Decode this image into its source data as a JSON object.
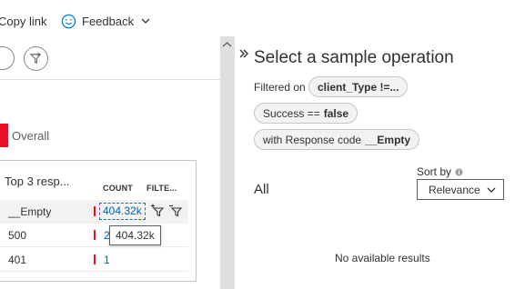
{
  "toolbar": {
    "copy_link_label": "Copy link",
    "feedback_label": "Feedback",
    "feedback_icon": "smiley-icon"
  },
  "left": {
    "overall_label": "Overall",
    "overall_color": "#e81123",
    "card": {
      "title": "Top 3 resp...",
      "columns": [
        "COUNT",
        "FILTE..."
      ],
      "rows": [
        {
          "code": "__Empty",
          "count": "404.32k"
        },
        {
          "code": "500",
          "count": "26"
        },
        {
          "code": "401",
          "count": "1"
        }
      ]
    },
    "tooltip": "404.32k"
  },
  "right": {
    "title": "Select a sample operation",
    "filtered_on_label": "Filtered on",
    "chips": [
      {
        "key": "",
        "value": "client_Type !=..."
      },
      {
        "key": "Success ==",
        "value": "false"
      },
      {
        "key": "with Response code",
        "value": "__Empty"
      }
    ],
    "sort_by_label": "Sort by",
    "sort_value": "Relevance",
    "all_label": "All",
    "empty_message": "No available results"
  },
  "colors": {
    "accent": "#0078d4",
    "link": "#0063b1",
    "bar": "#e81123"
  }
}
